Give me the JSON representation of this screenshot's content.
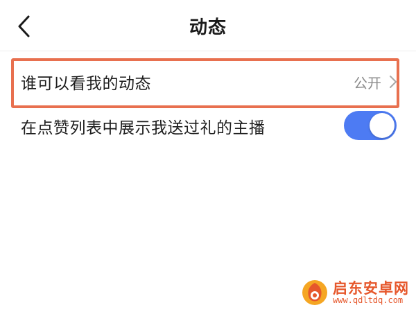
{
  "nav": {
    "title": "动态"
  },
  "settings": {
    "privacy_label": "谁可以看我的动态",
    "privacy_value": "公开",
    "gift_label": "在点赞列表中展示我送过礼的主播",
    "gift_toggle_on": true
  },
  "watermark": {
    "name": "启东安卓网",
    "url": "www.qdltdq.com"
  },
  "colors": {
    "highlight": "#e8704f",
    "toggle_on": "#4d7bf3",
    "watermark": "#e6572b"
  },
  "icons": {
    "back": "chevron-left-icon",
    "row_arrow": "chevron-right-icon",
    "logo": "watermark-logo-icon"
  }
}
